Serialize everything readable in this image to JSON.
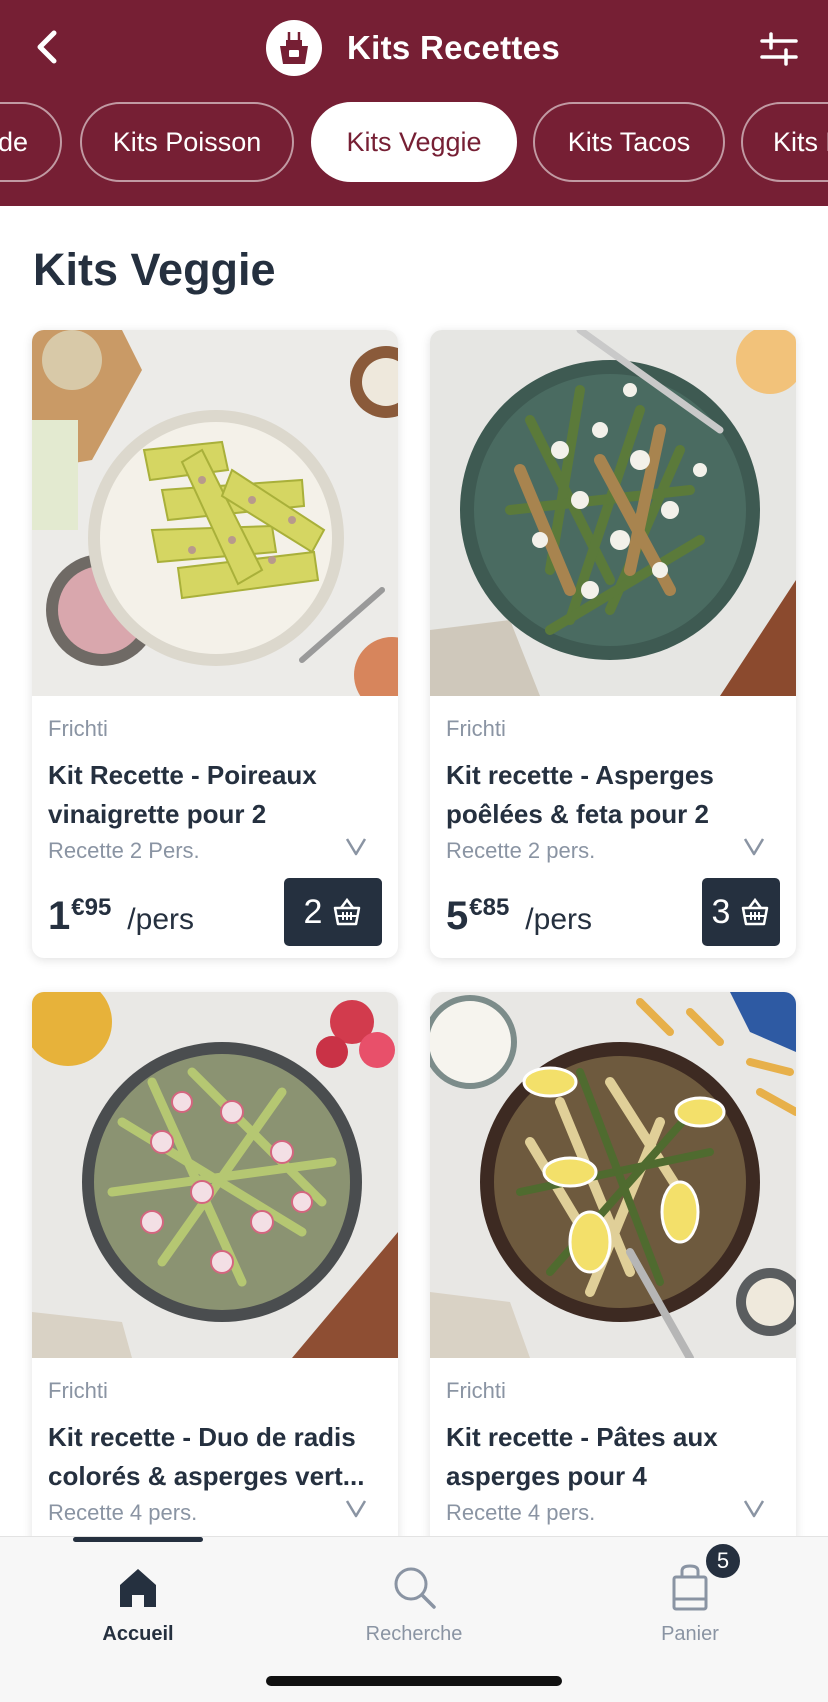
{
  "colors": {
    "brand": "#761f34",
    "dark": "#25303f",
    "muted": "#8a94a3",
    "white": "#ffffff"
  },
  "header": {
    "title": "Kits Recettes",
    "back_icon": "chevron-left-icon",
    "logo_icon": "apron-icon",
    "filter_icon": "sliders-icon"
  },
  "tabs": [
    {
      "label": "Kits Viande",
      "active": false
    },
    {
      "label": "Kits Poisson",
      "active": false
    },
    {
      "label": "Kits Veggie",
      "active": true
    },
    {
      "label": "Kits Tacos",
      "active": false
    },
    {
      "label": "Kits Desserts",
      "active": false
    }
  ],
  "page_title": "Kits Veggie",
  "products": [
    {
      "brand": "Frichti",
      "name_line1": "Kit Recette - Poireaux",
      "name_line2": "vinaigrette pour 2",
      "portion": "Recette 2 Pers.",
      "price_int": "1",
      "price_dec": "€95",
      "price_unit": "/pers",
      "cart_qty": "2",
      "image": "leeks-vinaigrette-dish"
    },
    {
      "brand": "Frichti",
      "name_line1": "Kit recette - Asperges",
      "name_line2": "poêlées & feta pour 2",
      "portion": "Recette 2 pers.",
      "price_int": "5",
      "price_dec": "€85",
      "price_unit": "/pers",
      "cart_qty": "3",
      "image": "asparagus-feta-dish"
    },
    {
      "brand": "Frichti",
      "name_line1": "Kit recette - Duo de radis",
      "name_line2": "colorés & asperges vert...",
      "portion": "Recette 4 pers.",
      "image": "radish-asparagus-salad"
    },
    {
      "brand": "Frichti",
      "name_line1": "Kit recette - Pâtes aux",
      "name_line2": "asperges pour 4",
      "portion": "Recette 4 pers.",
      "image": "asparagus-pasta-dish"
    }
  ],
  "bottom_nav": {
    "items": [
      {
        "label": "Accueil",
        "icon": "home-icon",
        "active": true
      },
      {
        "label": "Recherche",
        "icon": "search-icon",
        "active": false
      },
      {
        "label": "Panier",
        "icon": "bag-icon",
        "active": false
      }
    ],
    "cart_badge": "5"
  }
}
